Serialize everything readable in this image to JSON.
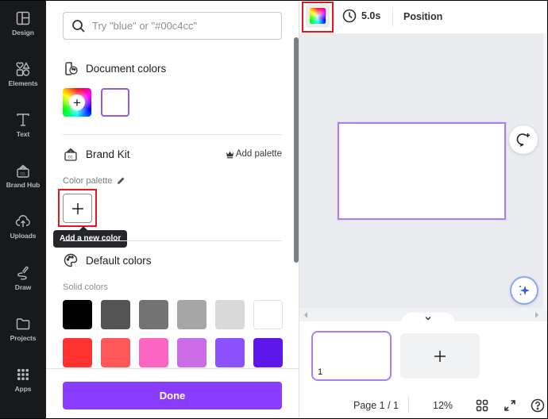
{
  "sidebar": {
    "items": [
      {
        "label": "Design",
        "icon": "layout-icon"
      },
      {
        "label": "Elements",
        "icon": "shapes-icon"
      },
      {
        "label": "Text",
        "icon": "text-icon"
      },
      {
        "label": "Brand Hub",
        "icon": "brand-icon"
      },
      {
        "label": "Uploads",
        "icon": "cloud-upload-icon"
      },
      {
        "label": "Draw",
        "icon": "draw-icon"
      },
      {
        "label": "Projects",
        "icon": "folder-icon"
      },
      {
        "label": "Apps",
        "icon": "apps-grid-icon"
      }
    ]
  },
  "color_panel": {
    "search": {
      "placeholder": "Try \"blue\" or \"#00c4cc\"",
      "value": ""
    },
    "document_colors": {
      "title": "Document colors",
      "colors": [
        "#ffffff"
      ],
      "highlight": "#8b5cf6"
    },
    "brand_kit": {
      "title": "Brand Kit",
      "add_palette_label": "Add palette",
      "palette_label": "Color palette",
      "add_color_tooltip": "Add a new color"
    },
    "default_colors": {
      "title": "Default colors",
      "solid_label": "Solid colors",
      "rows": [
        [
          "#000000",
          "#545454",
          "#737373",
          "#a6a6a6",
          "#d9d9d9",
          "#ffffff"
        ],
        [
          "#ff3131",
          "#ff5757",
          "#ff66c4",
          "#cb6ce6",
          "#8c52ff",
          "#5e17eb"
        ]
      ]
    },
    "done_label": "Done"
  },
  "toolbar": {
    "duration": "5.0s",
    "position_label": "Position"
  },
  "pages": {
    "thumbnails": [
      {
        "number": "1"
      }
    ],
    "page_indicator": "Page 1 / 1",
    "zoom": "12%"
  },
  "colors": {
    "accent": "#8b3dff",
    "highlight_box": "#e8161d",
    "rail_bg": "#18191b",
    "canvas_bg": "#ebecf0"
  }
}
